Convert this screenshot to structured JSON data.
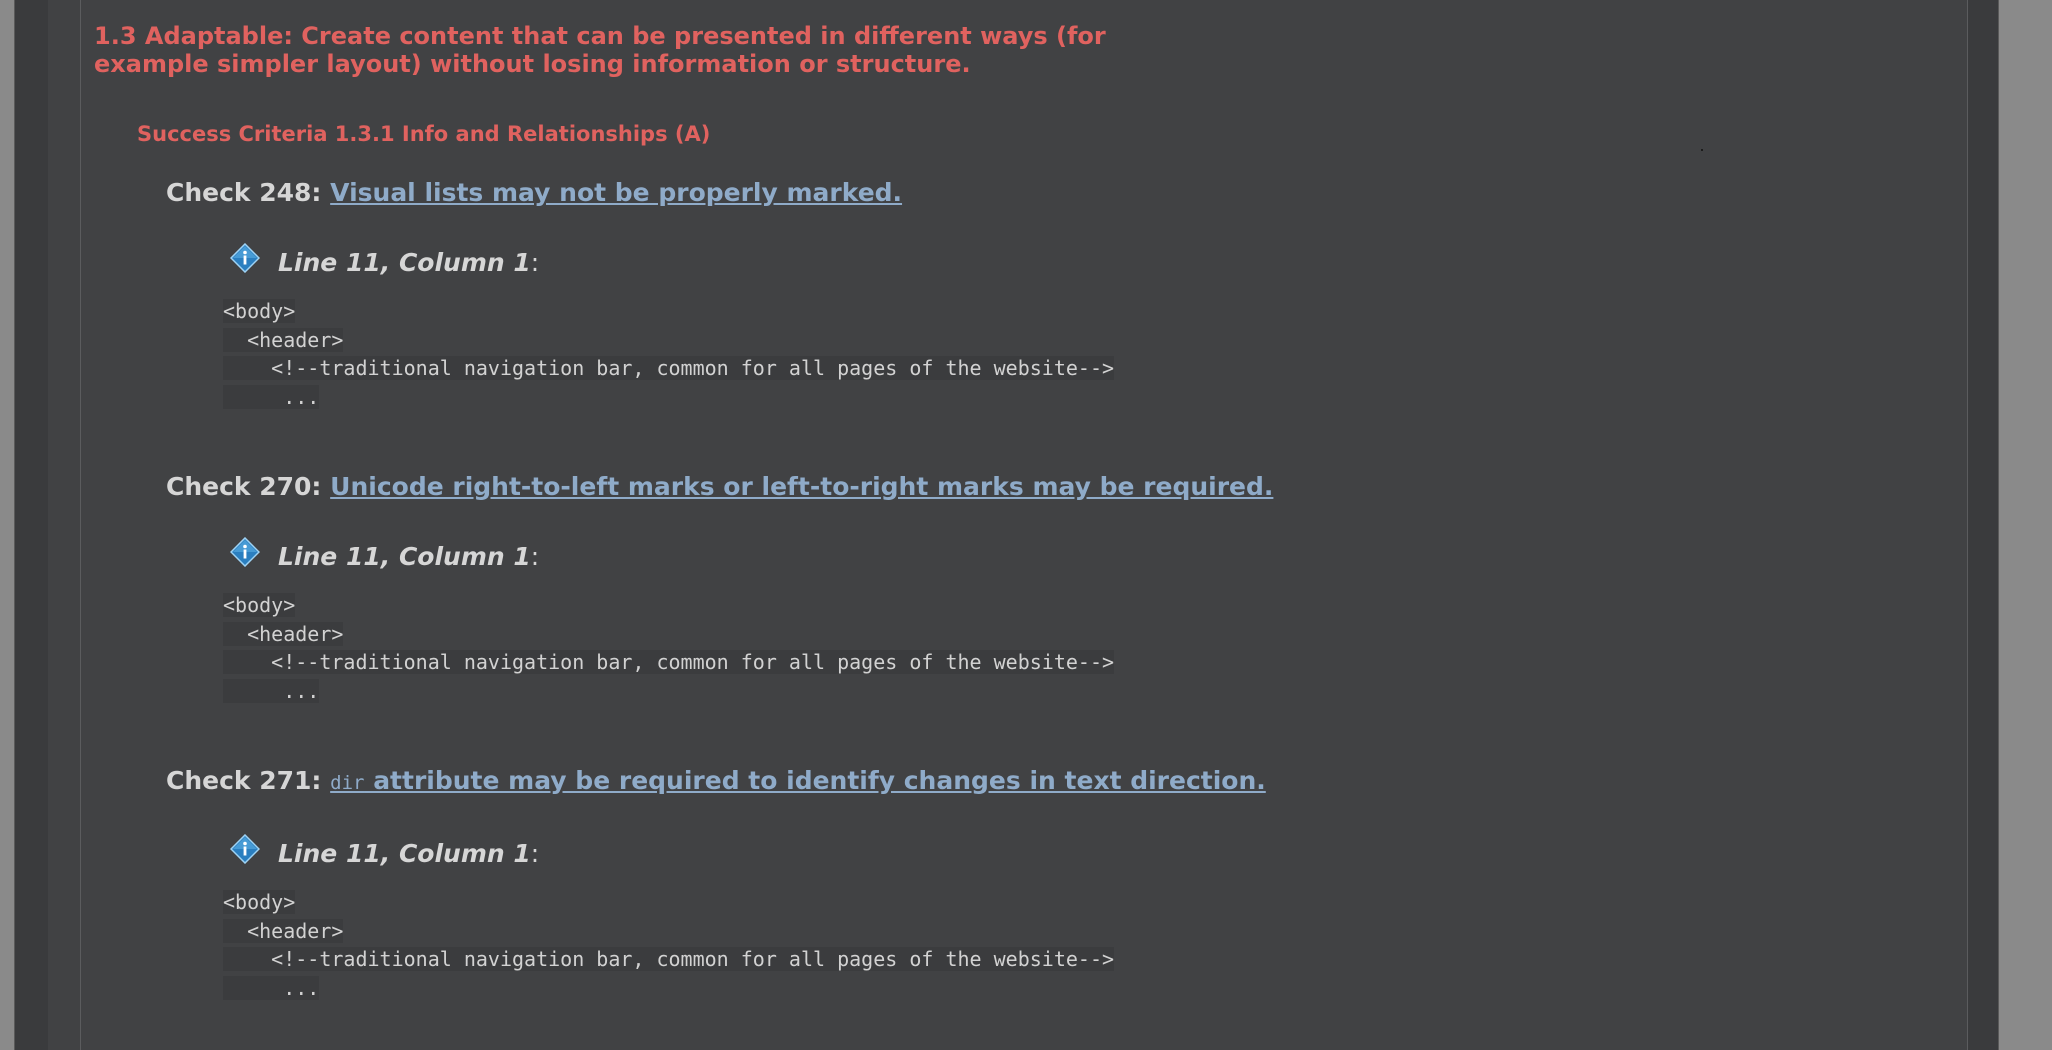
{
  "guideline": {
    "line1": "1.3 Adaptable: Create content that can be presented in different ways (for",
    "line2": "example simpler layout) without losing information or structure."
  },
  "criteria": "Success Criteria 1.3.1 Info and Relationships (A)",
  "checks": [
    {
      "prefix": "Check 248:",
      "link_text": "Visual lists may not be properly marked.",
      "location": "Line 11, Column 1",
      "colon": ":",
      "code": [
        "<body>",
        "  <header>",
        "    <!--traditional navigation bar, common for all pages of the website-->",
        "     ..."
      ]
    },
    {
      "prefix": "Check 270:",
      "link_text": "Unicode right-to-left marks or left-to-right marks may be required.",
      "location": "Line 11, Column 1",
      "colon": ":",
      "code": [
        "<body>",
        "  <header>",
        "    <!--traditional navigation bar, common for all pages of the website-->",
        "     ..."
      ]
    },
    {
      "prefix": "Check 271:",
      "link_code": "dir",
      "link_text": " attribute may be required to identify changes in text direction.",
      "location": "Line 11, Column 1",
      "colon": ":",
      "code": [
        "<body>",
        "  <header>",
        "    <!--traditional navigation bar, common for all pages of the website-->",
        "     ..."
      ]
    }
  ],
  "icons": {
    "location": "info-icon"
  },
  "colors": {
    "heading": "#e0625f",
    "link": "#8fabc9",
    "background": "#414244",
    "text": "#d6d6d6"
  }
}
